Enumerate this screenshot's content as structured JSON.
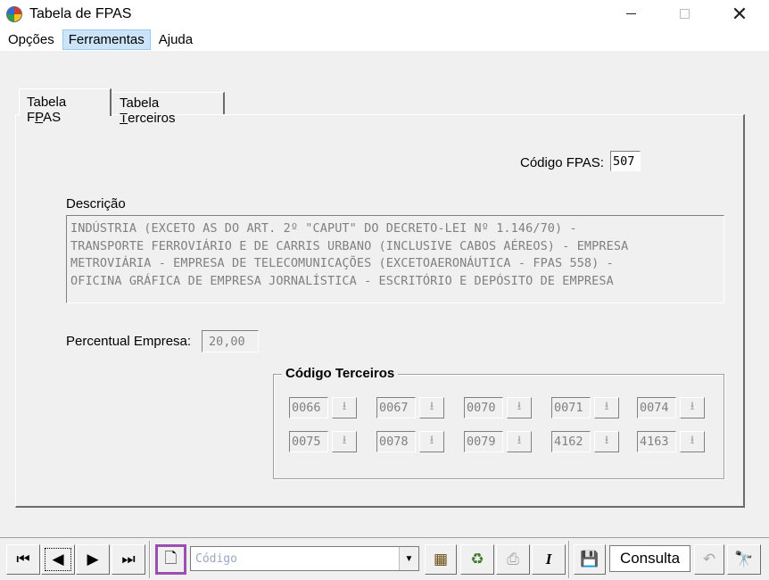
{
  "window": {
    "title": "Tabela de FPAS"
  },
  "menu": [
    "Opções",
    "Ferramentas",
    "Ajuda"
  ],
  "tabs": {
    "fpas": {
      "prefix": "Tabela F",
      "mnemonic": "P",
      "suffix": "AS"
    },
    "terceiros": {
      "prefix": "Tabela ",
      "mnemonic": "T",
      "suffix": "erceiros"
    }
  },
  "form": {
    "codigo_label": "Código FPAS:",
    "codigo_value": "507",
    "descricao_label": "Descrição",
    "descricao_value": "INDÚSTRIA (EXCETO AS DO ART. 2º \"CAPUT\" DO DECRETO-LEI Nº 1.146/70) -\nTRANSPORTE FERROVIÁRIO E DE CARRIS URBANO (INCLUSIVE CABOS AÉREOS) - EMPRESA\nMETROVIÁRIA - EMPRESA DE TELECOMUNICAÇÕES (EXCETOAERONÁUTICA - FPAS 558) -\nOFICINA GRÁFICA DE EMPRESA JORNALÍSTICA - ESCRITÓRIO E DEPÓSITO DE EMPRESA",
    "percentual_label": "Percentual Empresa:",
    "percentual_value": "20,00"
  },
  "terceiros": {
    "title": "Código Terceiros",
    "codes": [
      "0066",
      "0067",
      "0070",
      "0071",
      "0074",
      "0075",
      "0078",
      "0079",
      "4162",
      "4163"
    ]
  },
  "toolbar": {
    "combo_value": "Código",
    "mode": "Consulta"
  }
}
